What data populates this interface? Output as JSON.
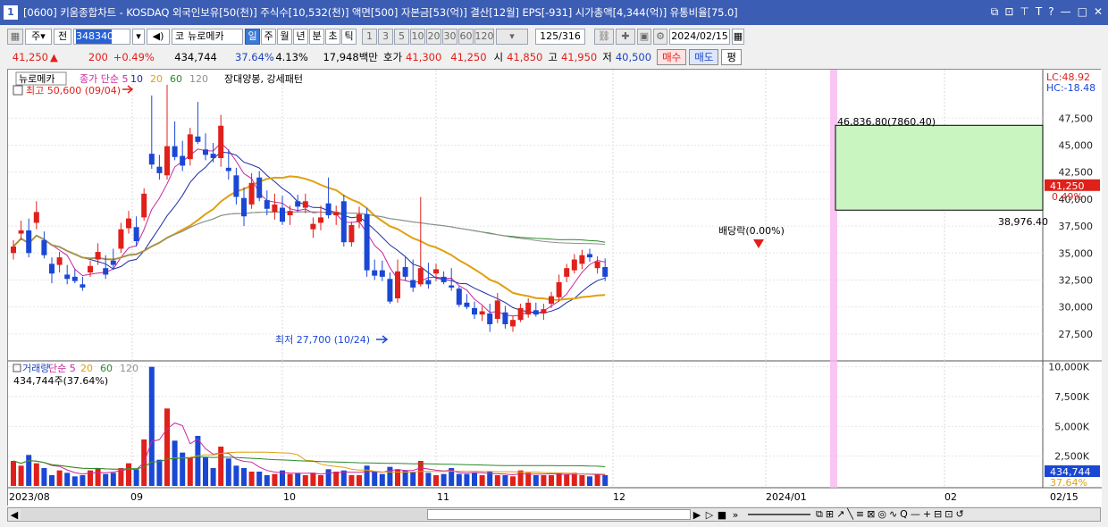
{
  "window": {
    "title": "[0600] 키움종합차트 - KOSDAQ 외국인보유[50(천)] 주식수[10,532(천)] 액면[500] 자본금[53(억)] 결산[12월] EPS[-931] 시가총액[4,344(억)] 유통비율[75.0]",
    "app_number": "1",
    "controls": [
      "⧉",
      "⊡",
      "⊤",
      "T",
      "?",
      "—",
      "□",
      "✕"
    ]
  },
  "toolbar": {
    "market_tab": "주",
    "prev_label": "전",
    "stock_code": "348340",
    "market_code": "코",
    "stock_name": "뉴로메카",
    "periods": [
      "일",
      "주",
      "월",
      "년",
      "분",
      "초",
      "틱"
    ],
    "selected_period": "일",
    "minute_options": [
      "1",
      "3",
      "5",
      "10",
      "20",
      "30",
      "60",
      "120"
    ],
    "count": "125",
    "total": "/316",
    "date": "2024/02/15"
  },
  "quote": {
    "price": "41,250",
    "arrow": "▲",
    "change": "200",
    "change_pct": "+0.49%",
    "volume": "434,744",
    "volume_ratio": "37.64%",
    "turnover": "4.13%",
    "amount": "17,948백만",
    "ask_label": "호가",
    "ask1": "41,300",
    "ask2": "41,250",
    "open_label": "시",
    "open": "41,850",
    "high_label": "고",
    "high": "41,950",
    "low_label": "저",
    "low": "40,500",
    "buy_label": "매수",
    "sell_label": "매도",
    "eval_label": "평"
  },
  "price_panel": {
    "stock_tag": "뉴로메카",
    "legend": [
      {
        "text": "종가 단순 5",
        "color": "#c828a0"
      },
      {
        "text": "10",
        "color": "#1c2da8"
      },
      {
        "text": "20",
        "color": "#e0a010"
      },
      {
        "text": "60",
        "color": "#2a8a2a"
      },
      {
        "text": "120",
        "color": "#909090"
      }
    ],
    "pattern_label": "장대양봉, 강세패턴",
    "high_note": "최고 50,600 (09/04)",
    "low_note": "최저 27,700 (10/24)",
    "dividend_note": "배당락(0.00%)",
    "box_high_note": "46,836.80(7860.40)",
    "box_low_note": "38,976.40",
    "lc": "LC:48.92",
    "hc": "HC:-18.48",
    "price_tag": "41,250",
    "price_tag_pct": "0.49%",
    "y_ticks": [
      "47,500",
      "45,000",
      "42,500",
      "40,000",
      "37,500",
      "35,000",
      "32,500",
      "30,000",
      "27,500"
    ]
  },
  "volume_panel": {
    "legend": [
      {
        "text": "거래량",
        "color": "#1c44c0"
      },
      {
        "text": "단순 5",
        "color": "#c828a0"
      },
      {
        "text": "20",
        "color": "#e0a010"
      },
      {
        "text": "60",
        "color": "#2a8a2a"
      },
      {
        "text": "120",
        "color": "#909090"
      }
    ],
    "current": "434,744주(37.64%)",
    "y_ticks": [
      "10,000K",
      "7,500K",
      "5,000K",
      "2,500K"
    ],
    "vol_tag": "434,744",
    "vol_pct_tag": "37.64%"
  },
  "x_axis": {
    "labels": [
      "2023/08",
      "09",
      "10",
      "11",
      "12",
      "2024/01",
      "02",
      "02/15"
    ]
  },
  "chart_data": {
    "type": "candlestick",
    "price_range": [
      26000,
      51000
    ],
    "volume_range_k": [
      0,
      10500
    ],
    "candles": [
      {
        "o": 35000,
        "h": 36200,
        "l": 34400,
        "c": 35600
      },
      {
        "o": 36800,
        "h": 38000,
        "l": 36200,
        "c": 37100
      },
      {
        "o": 37100,
        "h": 38200,
        "l": 34600,
        "c": 35000
      },
      {
        "o": 37800,
        "h": 39800,
        "l": 37200,
        "c": 38800
      },
      {
        "o": 36200,
        "h": 37000,
        "l": 34500,
        "c": 34800
      },
      {
        "o": 34000,
        "h": 34600,
        "l": 32200,
        "c": 33100
      },
      {
        "o": 33900,
        "h": 35100,
        "l": 33200,
        "c": 34600
      },
      {
        "o": 33000,
        "h": 33900,
        "l": 32100,
        "c": 32600
      },
      {
        "o": 32800,
        "h": 33500,
        "l": 32200,
        "c": 32400
      },
      {
        "o": 32100,
        "h": 32800,
        "l": 31500,
        "c": 31800
      },
      {
        "o": 33200,
        "h": 34300,
        "l": 32800,
        "c": 33800
      },
      {
        "o": 34400,
        "h": 35900,
        "l": 33900,
        "c": 35100
      },
      {
        "o": 33600,
        "h": 34800,
        "l": 32600,
        "c": 33000
      },
      {
        "o": 34300,
        "h": 35400,
        "l": 33500,
        "c": 33900
      },
      {
        "o": 35400,
        "h": 37800,
        "l": 35000,
        "c": 37200
      },
      {
        "o": 37300,
        "h": 38900,
        "l": 36800,
        "c": 38200
      },
      {
        "o": 37400,
        "h": 38400,
        "l": 35600,
        "c": 36100
      },
      {
        "o": 38300,
        "h": 41000,
        "l": 38000,
        "c": 40500
      },
      {
        "o": 44200,
        "h": 49600,
        "l": 42800,
        "c": 43200
      },
      {
        "o": 43000,
        "h": 44100,
        "l": 41800,
        "c": 42400
      },
      {
        "o": 42200,
        "h": 50600,
        "l": 41800,
        "c": 44900
      },
      {
        "o": 44900,
        "h": 47200,
        "l": 43600,
        "c": 43900
      },
      {
        "o": 44000,
        "h": 45400,
        "l": 42600,
        "c": 43100
      },
      {
        "o": 43700,
        "h": 46600,
        "l": 43100,
        "c": 46000
      },
      {
        "o": 45800,
        "h": 49000,
        "l": 45100,
        "c": 45300
      },
      {
        "o": 44600,
        "h": 46100,
        "l": 43600,
        "c": 44100
      },
      {
        "o": 44200,
        "h": 45200,
        "l": 43400,
        "c": 43800
      },
      {
        "o": 43800,
        "h": 47800,
        "l": 43000,
        "c": 46800
      },
      {
        "o": 42900,
        "h": 44600,
        "l": 41800,
        "c": 42600
      },
      {
        "o": 42200,
        "h": 42900,
        "l": 39500,
        "c": 40200
      },
      {
        "o": 40100,
        "h": 41100,
        "l": 37500,
        "c": 38400
      },
      {
        "o": 39500,
        "h": 42400,
        "l": 39100,
        "c": 41500
      },
      {
        "o": 42000,
        "h": 42600,
        "l": 39800,
        "c": 40100
      },
      {
        "o": 39900,
        "h": 40800,
        "l": 38500,
        "c": 39100
      },
      {
        "o": 38800,
        "h": 40500,
        "l": 38100,
        "c": 39500
      },
      {
        "o": 39200,
        "h": 40300,
        "l": 37600,
        "c": 37900
      },
      {
        "o": 38500,
        "h": 39400,
        "l": 37600,
        "c": 38900
      },
      {
        "o": 39800,
        "h": 40400,
        "l": 38800,
        "c": 39300
      },
      {
        "o": 39200,
        "h": 40500,
        "l": 38700,
        "c": 39800
      },
      {
        "o": 37200,
        "h": 38300,
        "l": 36400,
        "c": 37700
      },
      {
        "o": 37800,
        "h": 39400,
        "l": 37100,
        "c": 38300
      },
      {
        "o": 39600,
        "h": 42000,
        "l": 38200,
        "c": 38500
      },
      {
        "o": 38500,
        "h": 39400,
        "l": 37600,
        "c": 38800
      },
      {
        "o": 39800,
        "h": 40400,
        "l": 35600,
        "c": 36000
      },
      {
        "o": 36000,
        "h": 37900,
        "l": 35600,
        "c": 37600
      },
      {
        "o": 37900,
        "h": 39300,
        "l": 37300,
        "c": 38600
      },
      {
        "o": 38600,
        "h": 39200,
        "l": 32800,
        "c": 33400
      },
      {
        "o": 33400,
        "h": 34400,
        "l": 32500,
        "c": 32900
      },
      {
        "o": 33400,
        "h": 34300,
        "l": 32400,
        "c": 32800
      },
      {
        "o": 32600,
        "h": 33200,
        "l": 30300,
        "c": 30500
      },
      {
        "o": 30800,
        "h": 34400,
        "l": 30400,
        "c": 33300
      },
      {
        "o": 33700,
        "h": 34600,
        "l": 32400,
        "c": 32800
      },
      {
        "o": 32500,
        "h": 34400,
        "l": 31400,
        "c": 31800
      },
      {
        "o": 32100,
        "h": 40200,
        "l": 31900,
        "c": 33600
      },
      {
        "o": 32500,
        "h": 34100,
        "l": 31700,
        "c": 32100
      },
      {
        "o": 33100,
        "h": 34000,
        "l": 32400,
        "c": 33500
      },
      {
        "o": 32800,
        "h": 33300,
        "l": 32100,
        "c": 32300
      },
      {
        "o": 32000,
        "h": 33600,
        "l": 31500,
        "c": 31800
      },
      {
        "o": 31700,
        "h": 31900,
        "l": 30000,
        "c": 30200
      },
      {
        "o": 30400,
        "h": 31200,
        "l": 29800,
        "c": 30000
      },
      {
        "o": 29900,
        "h": 30500,
        "l": 28900,
        "c": 29300
      },
      {
        "o": 29300,
        "h": 30100,
        "l": 28700,
        "c": 29600
      },
      {
        "o": 29400,
        "h": 30300,
        "l": 27700,
        "c": 28400
      },
      {
        "o": 28900,
        "h": 31300,
        "l": 28500,
        "c": 30600
      },
      {
        "o": 29500,
        "h": 30100,
        "l": 28000,
        "c": 28400
      },
      {
        "o": 28200,
        "h": 29200,
        "l": 27700,
        "c": 28800
      },
      {
        "o": 28800,
        "h": 30300,
        "l": 28600,
        "c": 29900
      },
      {
        "o": 29300,
        "h": 30800,
        "l": 29000,
        "c": 30400
      },
      {
        "o": 29700,
        "h": 30400,
        "l": 29100,
        "c": 29300
      },
      {
        "o": 29400,
        "h": 30300,
        "l": 28800,
        "c": 29800
      },
      {
        "o": 30300,
        "h": 31400,
        "l": 29900,
        "c": 31000
      },
      {
        "o": 30900,
        "h": 33000,
        "l": 30500,
        "c": 32300
      },
      {
        "o": 32800,
        "h": 34000,
        "l": 32300,
        "c": 33600
      },
      {
        "o": 33400,
        "h": 34900,
        "l": 33100,
        "c": 34400
      },
      {
        "o": 34000,
        "h": 35300,
        "l": 33500,
        "c": 34800
      },
      {
        "o": 34900,
        "h": 35400,
        "l": 34200,
        "c": 34600
      },
      {
        "o": 33600,
        "h": 34700,
        "l": 33100,
        "c": 34200
      },
      {
        "o": 33700,
        "h": 34500,
        "l": 32400,
        "c": 32800
      }
    ],
    "volume_k": [
      2100,
      1700,
      2600,
      1900,
      1500,
      900,
      1300,
      1100,
      800,
      900,
      1300,
      1500,
      1000,
      1100,
      1500,
      1900,
      1400,
      3900,
      10000,
      2200,
      6500,
      3800,
      2800,
      2400,
      4200,
      2400,
      1500,
      3300,
      2300,
      1700,
      1500,
      1200,
      1200,
      900,
      1000,
      1300,
      1000,
      1100,
      900,
      1100,
      900,
      1400,
      1200,
      1300,
      900,
      900,
      1700,
      1200,
      1000,
      1600,
      1400,
      1300,
      1200,
      2100,
      1100,
      900,
      1000,
      1500,
      1000,
      1000,
      1100,
      900,
      1200,
      900,
      900,
      800,
      1300,
      1100,
      900,
      900,
      900,
      1100,
      1000,
      1100,
      900,
      800,
      1000,
      900
    ]
  }
}
